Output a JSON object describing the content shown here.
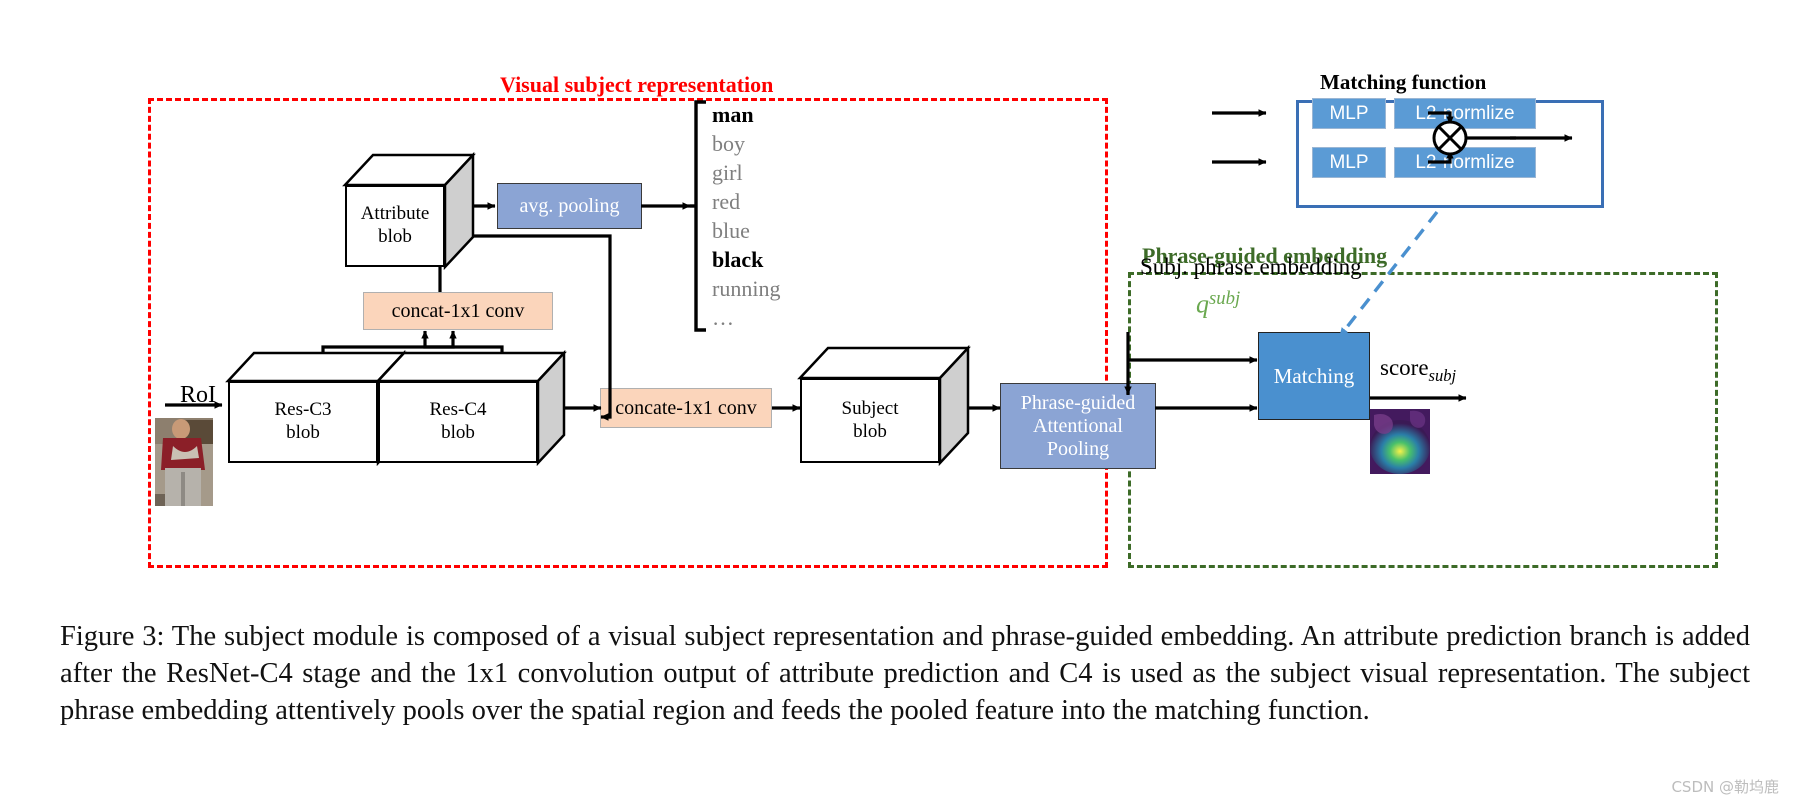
{
  "figure": {
    "regions": {
      "visual_subject": {
        "title": "Visual subject representation",
        "color": "#ff0000"
      },
      "phrase_guided": {
        "title": "Phrase-guided embedding",
        "color": "#3d6b28"
      },
      "matching_function": {
        "title": "Matching function",
        "color": "#3a6fb5"
      }
    },
    "inputs": {
      "roi_label": "RoI"
    },
    "blobs": [
      {
        "name": "attribute-blob",
        "line1": "Attribute",
        "line2": "blob"
      },
      {
        "name": "res-c3-blob",
        "line1": "Res-C3",
        "line2": "blob"
      },
      {
        "name": "res-c4-blob",
        "line1": "Res-C4",
        "line2": "blob"
      },
      {
        "name": "subject-blob",
        "line1": "Subject",
        "line2": "blob"
      }
    ],
    "ops": {
      "avg_pooling": "avg. pooling",
      "concat_conv_attr": "concat-1x1 conv",
      "concat_conv_subj": "concate-1x1 conv",
      "phrase_guided_pooling_line1": "Phrase-guided",
      "phrase_guided_pooling_line2": "Attentional",
      "phrase_guided_pooling_line3": "Pooling",
      "matching": "Matching",
      "mlp_top": "MLP",
      "mlp_bottom": "MLP",
      "l2_top": "L2-normlize",
      "l2_bottom": "L2-normlize",
      "multiply_symbol": "⊗"
    },
    "attributes": [
      {
        "word": "man",
        "style": "bold"
      },
      {
        "word": "boy",
        "style": "gray"
      },
      {
        "word": "girl",
        "style": "gray"
      },
      {
        "word": "red",
        "style": "gray"
      },
      {
        "word": "blue",
        "style": "gray"
      },
      {
        "word": "black",
        "style": "bold"
      },
      {
        "word": "running",
        "style": "gray"
      },
      {
        "word": "…",
        "style": "gray"
      }
    ],
    "phrase_embedding": {
      "label": "Subj. phrase embedding",
      "symbol_base": "q",
      "symbol_sup": "subj",
      "symbol_color": "#6aa84f"
    },
    "outputs": {
      "score_base": "score",
      "score_sub": "subj"
    }
  },
  "caption": {
    "text": "Figure 3: The subject module is composed of a visual subject representation and phrase-guided embedding. An attribute prediction branch is added after the ResNet-C4 stage and the 1x1 convolution output of attribute prediction and C4 is used as the subject visual representation. The subject phrase embedding attentively pools over the spatial region and feeds the pooled feature into the matching function."
  },
  "watermark": {
    "text": "CSDN @勒坞鹿"
  }
}
